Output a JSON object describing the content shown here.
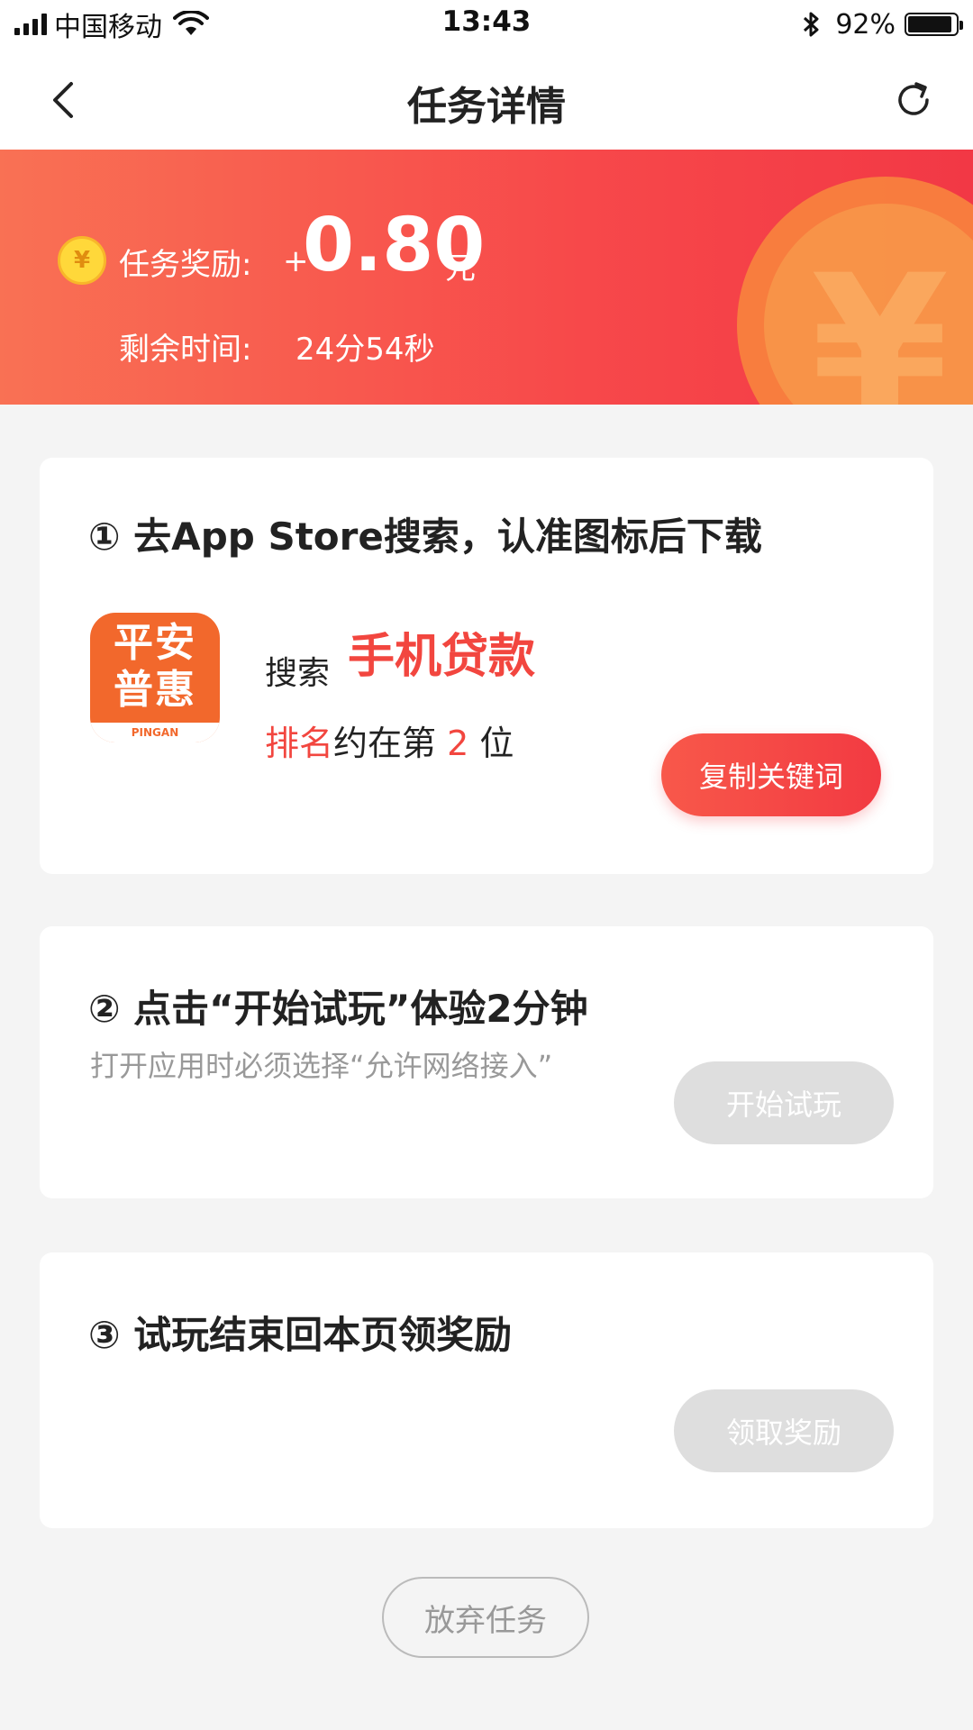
{
  "status_bar": {
    "carrier": "中国移动",
    "time": "13:43",
    "battery_percent": "92%",
    "battery_level": 0.92,
    "icons": [
      "signal-icon",
      "wifi-icon",
      "bluetooth-icon",
      "battery-icon"
    ]
  },
  "nav": {
    "title": "任务详情",
    "back_icon": "chevron-left-icon",
    "refresh_icon": "refresh-icon"
  },
  "header": {
    "reward_label": "任务奖励:",
    "reward_plus": "+",
    "reward_amount": "0.80",
    "reward_unit": "元",
    "coin_symbol": "¥",
    "time_label": "剩余时间:",
    "time_value": "24分54秒"
  },
  "step1": {
    "title": "① 去App Store搜索，认准图标后下载",
    "app_icon_text_line1": "平安",
    "app_icon_text_line2": "普惠",
    "app_icon_foot": "PINGAN",
    "search_label": "搜索",
    "search_keyword": "手机贷款",
    "rank_prefix": "排名",
    "rank_middle": "约在第",
    "rank_number": "2",
    "rank_suffix": "位",
    "copy_button": "复制关键词"
  },
  "step2": {
    "title": "② 点击“开始试玩”体验2分钟",
    "hint": "打开应用时必须选择“允许网络接入”",
    "start_button": "开始试玩"
  },
  "step3": {
    "title": "③ 试玩结束回本页领奖励",
    "claim_button": "领取奖励"
  },
  "abandon_button": "放弃任务",
  "colors": {
    "accent_red": "#f2463f",
    "banner_start": "#f97154",
    "banner_end": "#f23845",
    "disabled_button": "#dedede",
    "app_icon_orange": "#f2682c"
  }
}
